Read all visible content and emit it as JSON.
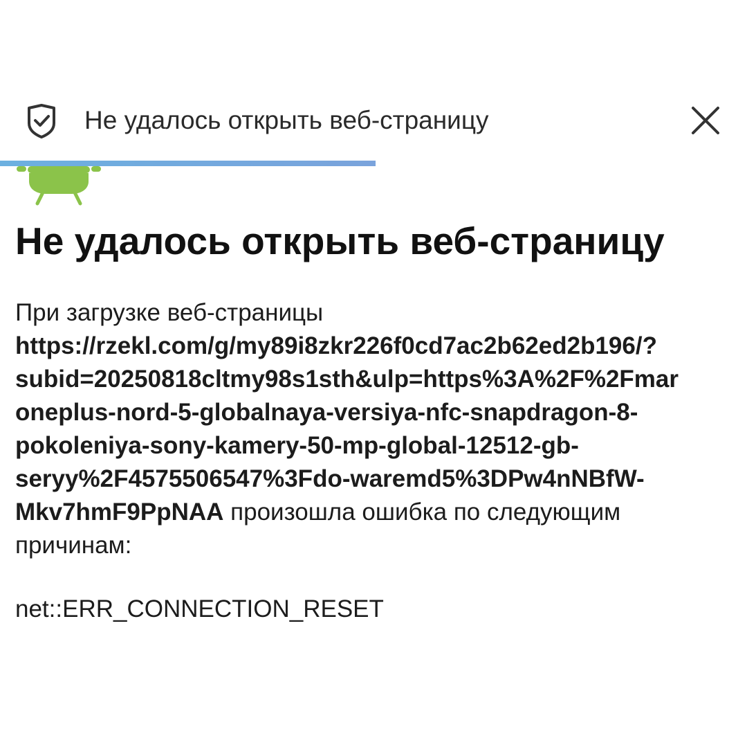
{
  "toolbar": {
    "title": "Не удалось открыть веб-страницу",
    "leading_icon": "shield-check-icon",
    "close_icon": "close-icon"
  },
  "progress": {
    "fraction": 0.503,
    "color": "#6cb0e0"
  },
  "error_page": {
    "image_icon": "android-robot-icon",
    "heading": "Не удалось открыть веб-страницу",
    "message_before": "При загрузке веб-страницы",
    "url_lines": [
      "https://rzekl.com/g/my89i8zkr226f0cd7ac2b62ed2b196/?",
      "subid=20250818cltmy98s1sth&ulp=https%3A%2F%2Fmar",
      "oneplus-nord-5-globalnaya-versiya-nfc-snapdragon-8-",
      "pokoleniya-sony-kamery-50-mp-global-12512-gb-",
      "seryy%2F4575506547%3Fdo-waremd5%3DPw4nNBfW-",
      "Mkv7hmF9PpNAA"
    ],
    "message_after_line": " произошла ошибка по следующим",
    "message_tail": "причинам:",
    "error_code": "net::ERR_CONNECTION_RESET",
    "robot_color": "#8bc34a"
  }
}
